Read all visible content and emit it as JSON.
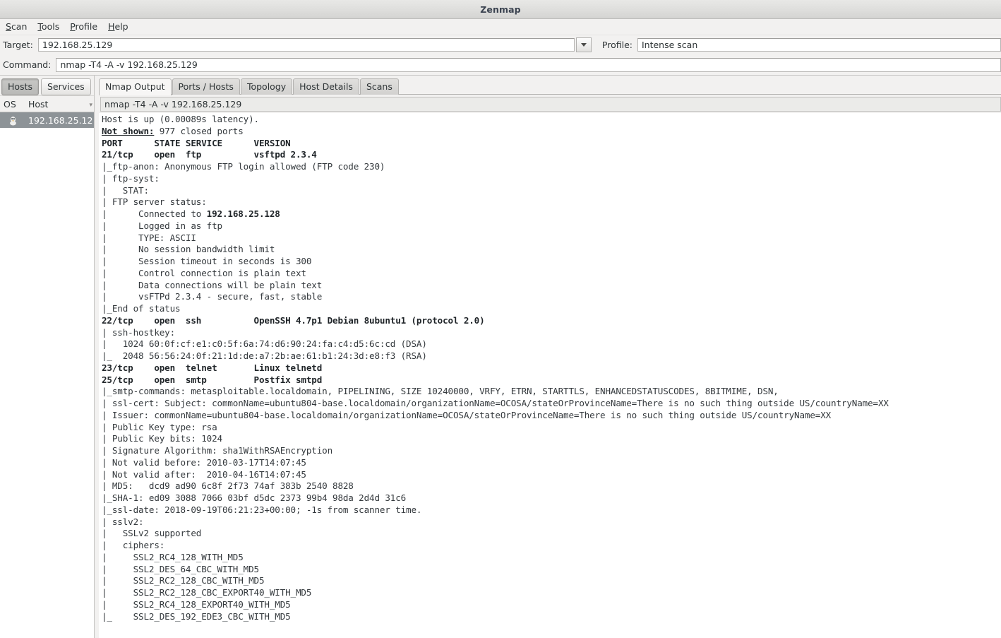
{
  "window": {
    "title": "Zenmap"
  },
  "menubar": {
    "items": [
      {
        "name": "scan",
        "label": "Scan",
        "accel": "S"
      },
      {
        "name": "tools",
        "label": "Tools",
        "accel": "T"
      },
      {
        "name": "profile",
        "label": "Profile",
        "accel": "P"
      },
      {
        "name": "help",
        "label": "Help",
        "accel": "H"
      }
    ]
  },
  "toolbar": {
    "target_label": "Target:",
    "target_value": "192.168.25.129",
    "target_placeholder": "",
    "profile_label": "Profile:",
    "profile_value": "Intense scan",
    "command_label": "Command:",
    "command_value": "nmap -T4 -A -v 192.168.25.129",
    "dropdown_icon": "chevron-down-icon"
  },
  "sidebar": {
    "tabs": [
      {
        "name": "hosts",
        "label": "Hosts",
        "active": true
      },
      {
        "name": "services",
        "label": "Services",
        "active": false
      }
    ],
    "columns": [
      "OS",
      "Host"
    ],
    "hosts": [
      {
        "os_icon": "penguin-icon",
        "host": "192.168.25.12",
        "selected": true
      }
    ]
  },
  "main": {
    "tabs": [
      {
        "name": "nmap-output",
        "label": "Nmap Output",
        "active": true
      },
      {
        "name": "ports-hosts",
        "label": "Ports / Hosts",
        "active": false
      },
      {
        "name": "topology",
        "label": "Topology",
        "active": false
      },
      {
        "name": "host-details",
        "label": "Host Details",
        "active": false
      },
      {
        "name": "scans",
        "label": "Scans",
        "active": false
      }
    ],
    "command_display": "nmap -T4 -A -v 192.168.25.129",
    "output_lines": [
      {
        "text": "Host is up (0.00089s latency)."
      },
      {
        "segments": [
          {
            "t": "Not shown:",
            "s": "bold-underline"
          },
          {
            "t": " 977 closed ports",
            "s": ""
          }
        ]
      },
      {
        "text": "PORT      STATE SERVICE      VERSION",
        "s": "bold"
      },
      {
        "text": "21/tcp    open  ftp          vsftpd 2.3.4",
        "s": "bold"
      },
      {
        "text": "|_ftp-anon: Anonymous FTP login allowed (FTP code 230)"
      },
      {
        "text": "| ftp-syst:"
      },
      {
        "text": "|   STAT:"
      },
      {
        "text": "| FTP server status:"
      },
      {
        "segments": [
          {
            "t": "|      Connected to ",
            "s": ""
          },
          {
            "t": "192.168.25.128",
            "s": "bold"
          }
        ]
      },
      {
        "text": "|      Logged in as ftp"
      },
      {
        "text": "|      TYPE: ASCII"
      },
      {
        "text": "|      No session bandwidth limit"
      },
      {
        "text": "|      Session timeout in seconds is 300"
      },
      {
        "text": "|      Control connection is plain text"
      },
      {
        "text": "|      Data connections will be plain text"
      },
      {
        "text": "|      vsFTPd 2.3.4 - secure, fast, stable"
      },
      {
        "text": "|_End of status"
      },
      {
        "text": "22/tcp    open  ssh          OpenSSH 4.7p1 Debian 8ubuntu1 (protocol 2.0)",
        "s": "bold"
      },
      {
        "text": "| ssh-hostkey:"
      },
      {
        "text": "|   1024 60:0f:cf:e1:c0:5f:6a:74:d6:90:24:fa:c4:d5:6c:cd (DSA)"
      },
      {
        "text": "|_  2048 56:56:24:0f:21:1d:de:a7:2b:ae:61:b1:24:3d:e8:f3 (RSA)"
      },
      {
        "text": "23/tcp    open  telnet       Linux telnetd",
        "s": "bold"
      },
      {
        "text": "25/tcp    open  smtp         Postfix smtpd",
        "s": "bold"
      },
      {
        "text": "|_smtp-commands: metasploitable.localdomain, PIPELINING, SIZE 10240000, VRFY, ETRN, STARTTLS, ENHANCEDSTATUSCODES, 8BITMIME, DSN,"
      },
      {
        "text": "| ssl-cert: Subject: commonName=ubuntu804-base.localdomain/organizationName=OCOSA/stateOrProvinceName=There is no such thing outside US/countryName=XX"
      },
      {
        "text": "| Issuer: commonName=ubuntu804-base.localdomain/organizationName=OCOSA/stateOrProvinceName=There is no such thing outside US/countryName=XX"
      },
      {
        "text": "| Public Key type: rsa"
      },
      {
        "text": "| Public Key bits: 1024"
      },
      {
        "text": "| Signature Algorithm: sha1WithRSAEncryption"
      },
      {
        "text": "| Not valid before: 2010-03-17T14:07:45"
      },
      {
        "text": "| Not valid after:  2010-04-16T14:07:45"
      },
      {
        "text": "| MD5:   dcd9 ad90 6c8f 2f73 74af 383b 2540 8828"
      },
      {
        "text": "|_SHA-1: ed09 3088 7066 03bf d5dc 2373 99b4 98da 2d4d 31c6"
      },
      {
        "text": "|_ssl-date: 2018-09-19T06:21:23+00:00; -1s from scanner time."
      },
      {
        "text": "| sslv2:"
      },
      {
        "text": "|   SSLv2 supported"
      },
      {
        "text": "|   ciphers:"
      },
      {
        "text": "|     SSL2_RC4_128_WITH_MD5"
      },
      {
        "text": "|     SSL2_DES_64_CBC_WITH_MD5"
      },
      {
        "text": "|     SSL2_RC2_128_CBC_WITH_MD5"
      },
      {
        "text": "|     SSL2_RC2_128_CBC_EXPORT40_WITH_MD5"
      },
      {
        "text": "|     SSL2_RC4_128_EXPORT40_WITH_MD5"
      },
      {
        "text": "|_    SSL2_DES_192_EDE3_CBC_WITH_MD5"
      }
    ]
  },
  "colors": {
    "window_bg": "#f2f1f0",
    "output_bg": "#ffffff",
    "text": "#2e3436",
    "mono_text": "#34393d",
    "selection_bg": "#8d9397",
    "border": "#b4b3b1"
  }
}
